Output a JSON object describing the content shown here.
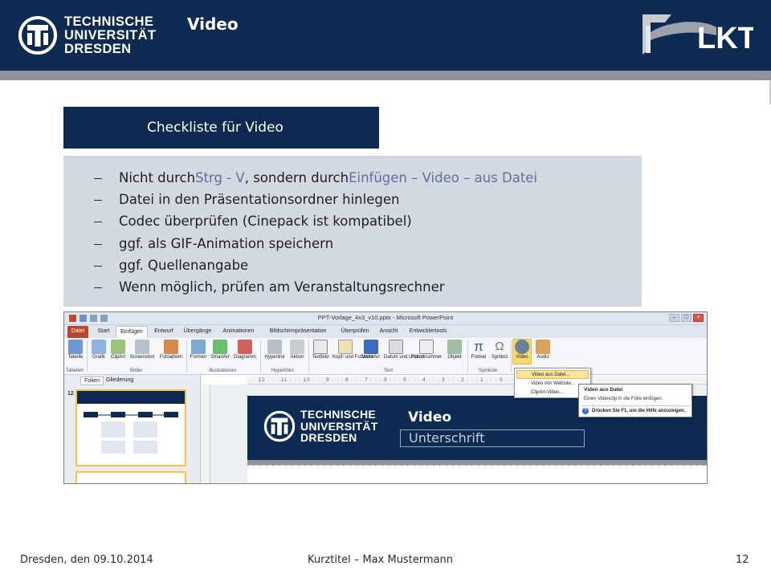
{
  "header": {
    "logo_lines": [
      "TECHNISCHE",
      "UNIVERSITÄT",
      "DRESDEN"
    ],
    "title": "Video",
    "partner_logo_text": "LKT",
    "color_primary": "#0d2a52",
    "color_strip": "#8e9299"
  },
  "checklist": {
    "heading": "Checkliste für Video",
    "items": [
      {
        "parts": [
          "Nicht durch ",
          "Strg - V",
          ", sondern durch ",
          "Einfügen – Video – aus Datei",
          ""
        ]
      },
      {
        "text": "Datei in den Präsentationsordner hinlegen"
      },
      {
        "text": "Codec überprüfen (Cinepack ist kompatibel)"
      },
      {
        "text": "ggf. als GIF-Animation speichern"
      },
      {
        "text": "ggf. Quellenangabe"
      },
      {
        "text": "Wenn möglich, prüfen am Veranstaltungsrechner"
      }
    ]
  },
  "screenshot": {
    "window_title": "PPT-Vorlage_4x3_v10.pptx - Microsoft PowerPoint",
    "tabs": [
      "Datei",
      "Start",
      "Einfügen",
      "Entwurf",
      "Übergänge",
      "Animationen",
      "Bildschirmpräsentation",
      "Überprüfen",
      "Ansicht",
      "Entwicklertools"
    ],
    "active_tab": "Einfügen",
    "ribbon_buttons": [
      "Tabelle",
      "Grafik",
      "ClipArt",
      "Screenshot",
      "Fotoalbum",
      "Formen",
      "SmartArt",
      "Diagramm",
      "Hyperlink",
      "Aktion",
      "Textfeld",
      "Kopf- und Fußzeile",
      "WordArt",
      "Datum und Uhrzeit",
      "Foliennummer",
      "Objekt",
      "Formel",
      "Symbol",
      "Video",
      "Audio"
    ],
    "ribbon_groups": [
      "Tabellen",
      "Bilder",
      "Illustrationen",
      "Hyperlinks",
      "Text",
      "Symbole"
    ],
    "pane_tabs": [
      "Folien",
      "Gliederung"
    ],
    "slide_number": "12",
    "ruler_text": "· 12 · · · 11 · · · 10 · · · 9 · · · 8 · · · 7 · · · 6 · · · 5 · · · 4 · · · 3 · · · 2 · · · 1 · · · 0 · · · 1 · · · 2 · · · 3 · · ·",
    "video_menu": [
      "Video aus Datei...",
      "Video von Website...",
      "ClipArt-Video..."
    ],
    "tooltip": {
      "title": "Video aus Datei",
      "text": "Einen Videoclip in die Folie einfügen.",
      "help": "Drücken Sie F1, um die Hilfe anzuzeigen."
    },
    "slide_logo_lines": [
      "TECHNISCHE",
      "UNIVERSITÄT",
      "DRESDEN"
    ],
    "slide_title": "Video",
    "slide_subtitle": "Unterschrift"
  },
  "footer": {
    "left": "Dresden, den 09.10.2014",
    "center": "Kurztitel – Max Mustermann",
    "page": "12"
  }
}
